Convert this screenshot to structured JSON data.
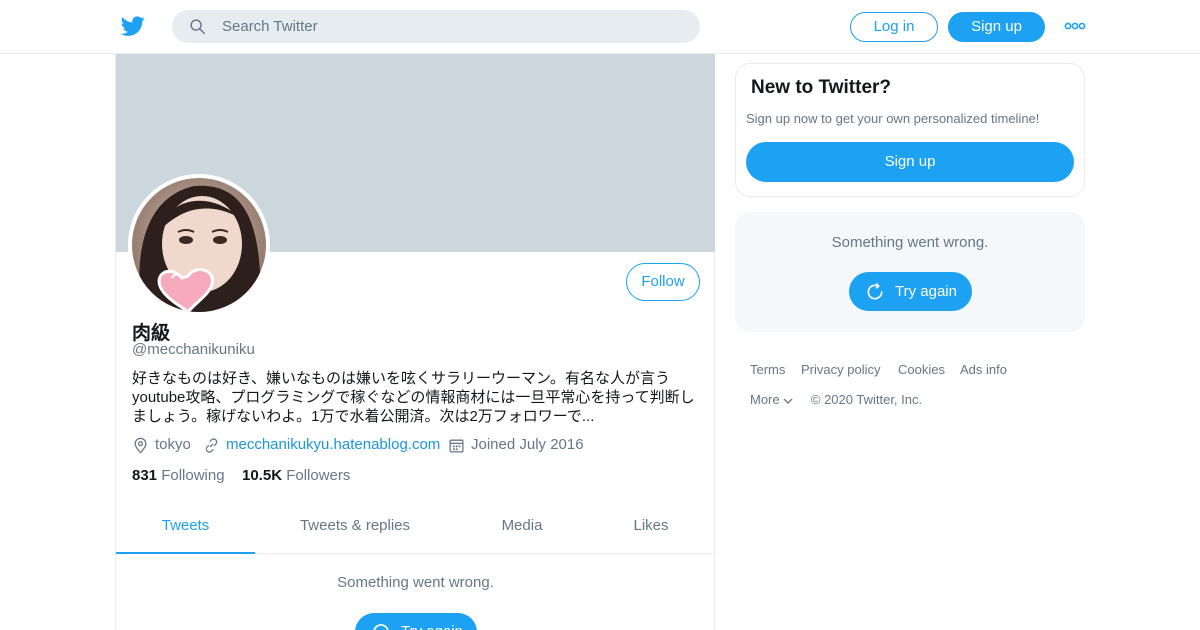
{
  "topbar": {
    "logo_icon": "twitter-bird-icon",
    "search_placeholder": "Search Twitter",
    "login_label": "Log in",
    "signup_label": "Sign up",
    "more_icon": "more-dots-icon"
  },
  "profile": {
    "display_name": "肉級",
    "handle": "@mecchanikuniku",
    "follow_label": "Follow",
    "bio": "好きなものは好き、嫌いなものは嫌いを呟くサラリーウーマン。有名な人が言うyoutube攻略、プログラミングで稼ぐなどの情報商材には一旦平常心を持って判断しましょう。稼げないわよ。1万で水着公開済。次は2万フォロワーで...",
    "location": "tokyo",
    "website": "mecchanikukyu.hatenablog.com",
    "joined": "Joined July 2016",
    "following_count": "831",
    "following_label": "Following",
    "followers_count": "10.5K",
    "followers_label": "Followers"
  },
  "tabs": [
    {
      "label": "Tweets",
      "active": true
    },
    {
      "label": "Tweets & replies",
      "active": false
    },
    {
      "label": "Media",
      "active": false
    },
    {
      "label": "Likes",
      "active": false
    }
  ],
  "timeline": {
    "error_message": "Something went wrong.",
    "retry_label": "Try again"
  },
  "sidebar": {
    "new_title": "New to Twitter?",
    "new_text": "Sign up now to get your own personalized timeline!",
    "signup_label": "Sign up",
    "error_message": "Something went wrong.",
    "retry_label": "Try again"
  },
  "footer": {
    "terms": "Terms",
    "privacy": "Privacy policy",
    "cookies": "Cookies",
    "ads": "Ads info",
    "more": "More",
    "copyright": "© 2020 Twitter, Inc."
  },
  "colors": {
    "accent": "#1da1f2",
    "banner": "#ccd6dd",
    "muted_text": "#657786"
  }
}
